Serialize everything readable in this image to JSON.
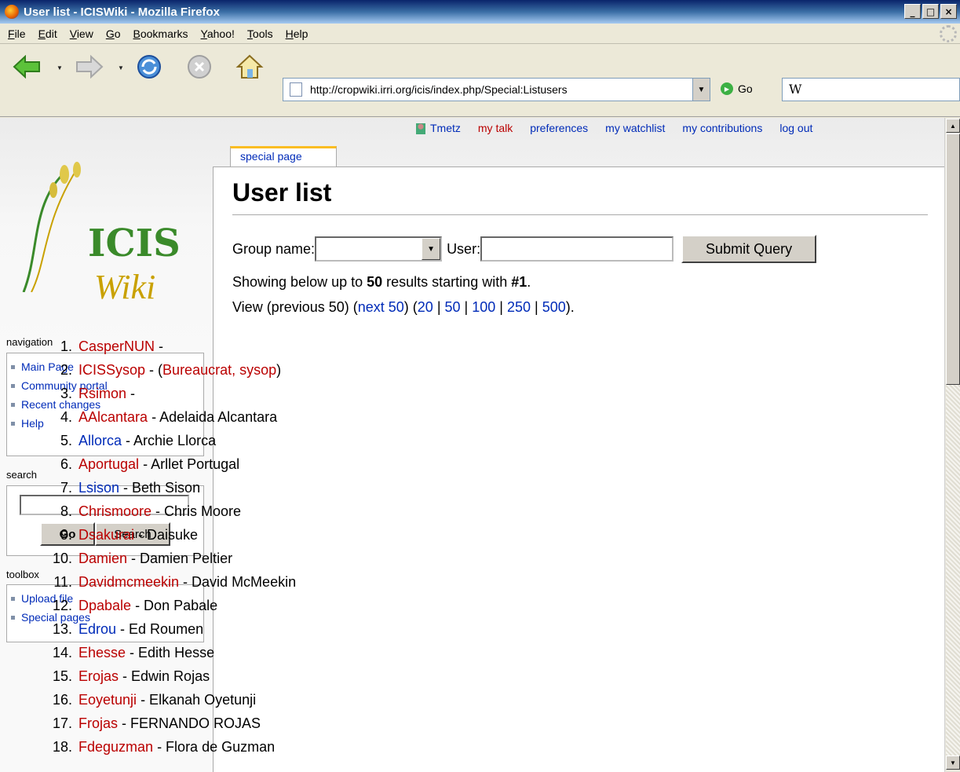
{
  "window": {
    "title": "User list - ICISWiki - Mozilla Firefox"
  },
  "menu": [
    "File",
    "Edit",
    "View",
    "Go",
    "Bookmarks",
    "Yahoo!",
    "Tools",
    "Help"
  ],
  "toolbar": {
    "url": "http://cropwiki.irri.org/icis/index.php/Special:Listusers",
    "go_label": "Go",
    "search_value": "W"
  },
  "personal": {
    "username": "Tmetz",
    "my_talk": "my talk",
    "preferences": "preferences",
    "watchlist": "my watchlist",
    "contributions": "my contributions",
    "logout": "log out"
  },
  "logo": {
    "line1": "ICIS",
    "line2": "Wiki"
  },
  "tab": {
    "label": "special page"
  },
  "sidebar": {
    "navigation_title": "navigation",
    "navigation": [
      "Main Page",
      "Community portal",
      "Recent changes",
      "Help"
    ],
    "search_title": "search",
    "go_button": "Go",
    "search_button": "Search",
    "toolbox_title": "toolbox",
    "toolbox": [
      "Upload file",
      "Special pages"
    ]
  },
  "main": {
    "title": "User list",
    "group_label": "Group name:",
    "user_label": "User:",
    "submit_label": "Submit Query",
    "showing_prefix": "Showing below up to ",
    "showing_count": "50",
    "showing_mid": " results starting with ",
    "showing_start": "#1",
    "showing_suffix": ".",
    "view_prefix": "View (previous 50) (",
    "next_label": "next 50",
    "view_mid": ") (",
    "limits": [
      "20",
      "50",
      "100",
      "250",
      "500"
    ],
    "view_suffix": ")."
  },
  "users": [
    {
      "num": "1.",
      "name": "CasperNUN",
      "exists": false,
      "rest": " -"
    },
    {
      "num": "2.",
      "name": "ICISSysop",
      "exists": false,
      "rest": " - (",
      "groups": "Bureaucrat, sysop",
      "tail": ")"
    },
    {
      "num": "3.",
      "name": "Rsimon",
      "exists": false,
      "rest": " -"
    },
    {
      "num": "4.",
      "name": "AAlcantara",
      "exists": false,
      "rest": " - Adelaida Alcantara"
    },
    {
      "num": "5.",
      "name": "Allorca",
      "exists": true,
      "rest": " - Archie Llorca"
    },
    {
      "num": "6.",
      "name": "Aportugal",
      "exists": false,
      "rest": " - Arllet Portugal"
    },
    {
      "num": "7.",
      "name": "Lsison",
      "exists": true,
      "rest": " - Beth Sison"
    },
    {
      "num": "8.",
      "name": "Chrismoore",
      "exists": false,
      "rest": " - Chris Moore"
    },
    {
      "num": "9.",
      "name": "Dsakurai",
      "exists": false,
      "rest": " - Daisuke"
    },
    {
      "num": "10.",
      "name": "Damien",
      "exists": false,
      "rest": " - Damien Peltier"
    },
    {
      "num": "11.",
      "name": "Davidmcmeekin",
      "exists": false,
      "rest": " - David McMeekin"
    },
    {
      "num": "12.",
      "name": "Dpabale",
      "exists": false,
      "rest": " - Don Pabale"
    },
    {
      "num": "13.",
      "name": "Edrou",
      "exists": true,
      "rest": " - Ed Roumen"
    },
    {
      "num": "14.",
      "name": "Ehesse",
      "exists": false,
      "rest": " - Edith Hesse"
    },
    {
      "num": "15.",
      "name": "Erojas",
      "exists": false,
      "rest": " - Edwin Rojas"
    },
    {
      "num": "16.",
      "name": "Eoyetunji",
      "exists": false,
      "rest": " - Elkanah Oyetunji"
    },
    {
      "num": "17.",
      "name": "Frojas",
      "exists": false,
      "rest": " - FERNANDO ROJAS"
    },
    {
      "num": "18.",
      "name": "Fdeguzman",
      "exists": false,
      "rest": " - Flora de Guzman"
    }
  ]
}
